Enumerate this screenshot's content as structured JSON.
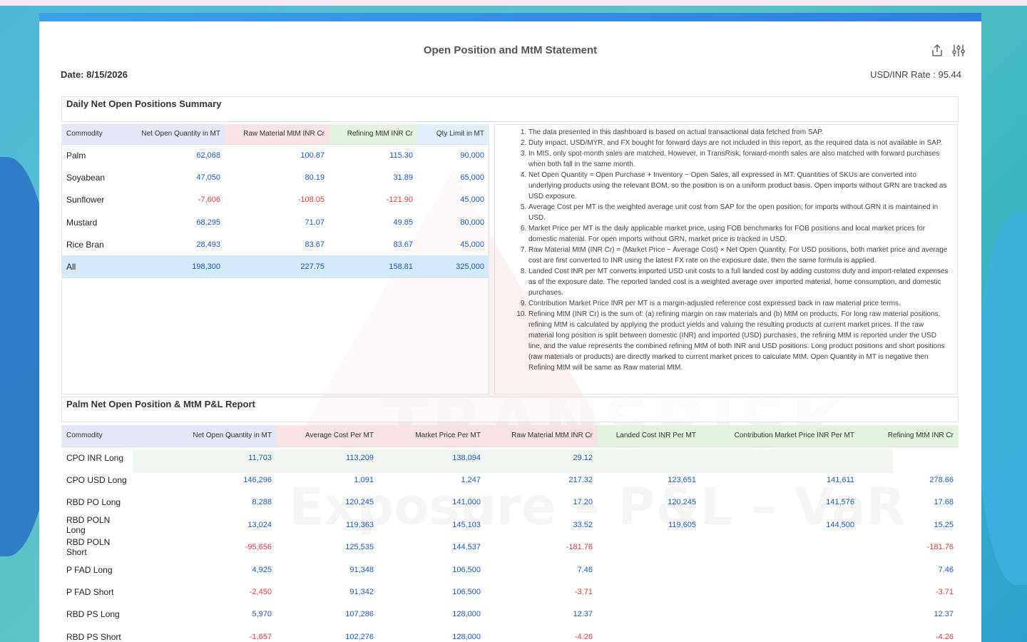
{
  "header": {
    "title": "Open Position and MtM Statement",
    "date_label": "Date: 8/15/2026",
    "rate_label": "USD/INR Rate : 95.44"
  },
  "icons": {
    "export": "export-icon",
    "filter": "filter-sliders-icon"
  },
  "watermark": {
    "line1": "TRANSRISK",
    "line2": "Exposure – P&L – VaR"
  },
  "summary": {
    "title": "Daily Net Open Positions Summary",
    "columns": [
      "Commodity",
      "Net Open Quantity in MT",
      "Raw Material MtM INR Cr",
      "Refining MtM INR Cr",
      "Qty Limit in MT"
    ],
    "rows": [
      [
        "Palm",
        "62,068",
        "100.87",
        "115.30",
        "90,000"
      ],
      [
        "Soyabean",
        "47,050",
        "80.19",
        "31.89",
        "65,000"
      ],
      [
        "Sunflower",
        "-7,606",
        "-108.05",
        "-121.90",
        "45,000"
      ],
      [
        "Mustard",
        "68,295",
        "71.07",
        "49.85",
        "80,000"
      ],
      [
        "Rice Bran",
        "28,493",
        "83.67",
        "83.67",
        "45,000"
      ]
    ],
    "total": [
      "All",
      "198,300",
      "227.75",
      "158.81",
      "325,000"
    ]
  },
  "notes": [
    "The data presented in this dashboard is based on actual transactional data fetched from SAP.",
    "Duty impact, USD/MYR, and FX bought for forward days are not included in this report, as the required data is not available in SAP.",
    "In MIS, only spot-month sales are matched. However, in TransRisk, forward-month sales are also matched with forward purchases when both fall in the same month.",
    "Net Open Quantity = Open Purchase + Inventory − Open Sales, all expressed in MT. Quantities of SKUs are converted into underlying products using the relevant BOM, so the position is on a uniform product basis. Open imports without GRN are tracked as USD exposure.",
    "Average Cost per MT is the weighted average unit cost from SAP for the open position; for imports without GRN it is maintained in USD.",
    "Market Price per MT is the daily applicable market price, using FOB benchmarks for FOB positions and local market prices for domestic material. For open imports without GRN, market price is tracked in USD.",
    "Raw Material MtM (INR Cr) = (Market Price − Average Cost) × Net Open Quantity. For USD positions, both market price and average cost are first converted to INR using the latest FX rate on the exposure date, then the same formula is applied.",
    "Landed Cost INR per MT converts imported USD unit costs to a full landed cost by adding customs duty and import-related expenses as of the exposure date. The reported landed cost is a weighted average over imported material, home consumption, and domestic purchases.",
    "Contribution Market Price INR per MT is a margin-adjusted reference cost expressed back in raw material price terms.",
    "Refining MtM (INR Cr) is the sum of: (a) refining margin on raw materials and (b) MtM on products. For long raw material positions, refining MtM is calculated by applying the product yields and valuing the resulting products at current market prices. If the raw material long position is split between domestic (INR) and imported (USD) purchases, the refining MtM is reported under the USD line, and the value represents the combined refining MtM of both INR and USD positions. Long product positions and short positions (raw materials or products) are directly marked to current market prices to calculate MtM. Open Quantity in MT is negative then Refining MtM will be same as Raw material MtM."
  ],
  "palm": {
    "title": "Palm Net Open Position & MtM P&L Report",
    "columns": [
      "Commodity",
      "Net Open Quantity in MT",
      "Average Cost Per MT",
      "Market Price Per MT",
      "Raw Material MtM INR Cr",
      "Landed Cost INR Per MT",
      "Contribution Market Price INR Per MT",
      "Refining MtM INR Cr"
    ],
    "rows": [
      [
        "CPO INR Long",
        "11,703",
        "113,209",
        "138,094",
        "29.12",
        "",
        "",
        ""
      ],
      [
        "CPO USD Long",
        "146,296",
        "1,091",
        "1,247",
        "217.32",
        "123,651",
        "141,611",
        "278.66"
      ],
      [
        "RBD PO Long",
        "8,288",
        "120,245",
        "141,000",
        "17.20",
        "120,245",
        "141,576",
        "17.68"
      ],
      [
        "RBD POLN Long",
        "13,024",
        "119,363",
        "145,103",
        "33.52",
        "119,605",
        "144,500",
        "15.25"
      ],
      [
        "RBD POLN Short",
        "-95,656",
        "125,535",
        "144,537",
        "-181.76",
        "",
        "",
        "-181.76"
      ],
      [
        "P FAD Long",
        "4,925",
        "91,348",
        "106,500",
        "7.46",
        "",
        "",
        "7.46"
      ],
      [
        "P FAD Short",
        "-2,450",
        "91,342",
        "106,500",
        "-3.71",
        "",
        "",
        "-3.71"
      ],
      [
        "RBD PS Long",
        "5,970",
        "107,286",
        "128,000",
        "12.37",
        "",
        "",
        "12.37"
      ],
      [
        "RBD PS Short",
        "-1,657",
        "102,276",
        "128,000",
        "-4.26",
        "",
        "",
        "-4.26"
      ]
    ]
  }
}
